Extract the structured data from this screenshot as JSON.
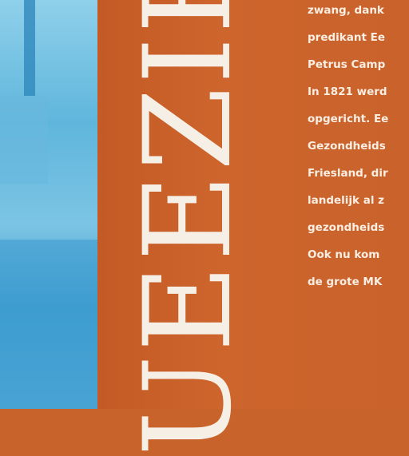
{
  "heading_fragment": "UEEZIE",
  "lines": [
    "zwang, dank",
    "predikant Ee",
    "Petrus Camp",
    "In 1821 werd",
    "opgericht. Ee",
    "Gezondheids",
    "Friesland, dir",
    "landelijk al z",
    "gezondheids",
    "Ook nu kom",
    "de grote MK"
  ]
}
